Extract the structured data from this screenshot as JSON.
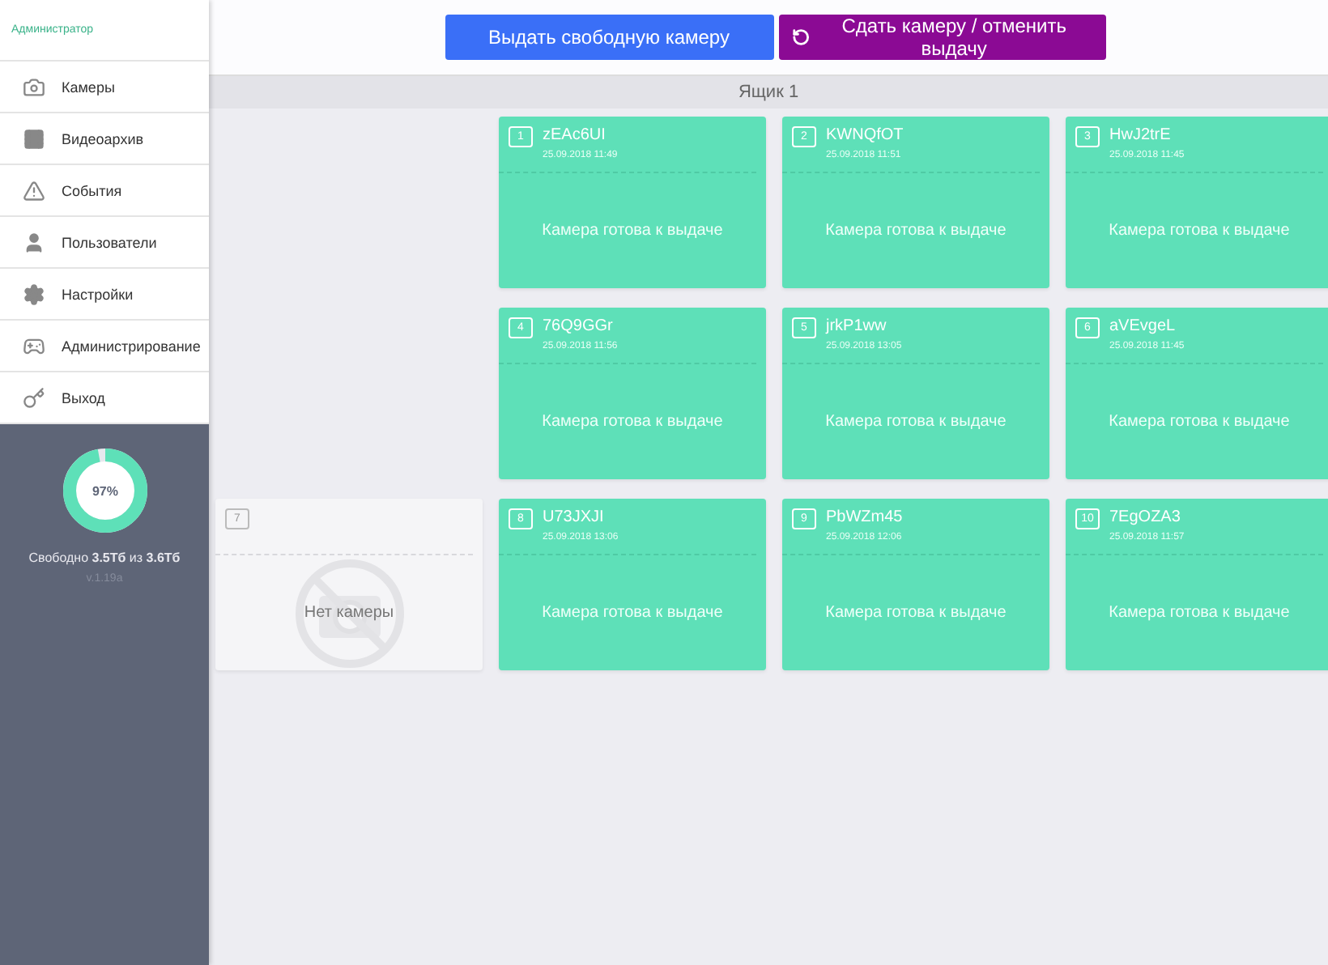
{
  "sidebar": {
    "role": "Администратор",
    "items": [
      {
        "label": "Камеры"
      },
      {
        "label": "Видеоархив"
      },
      {
        "label": "События"
      },
      {
        "label": "Пользователи"
      },
      {
        "label": "Настройки"
      },
      {
        "label": "Администрирование"
      },
      {
        "label": "Выход"
      }
    ],
    "storage": {
      "level": 0.97,
      "percent": "97%",
      "free": "Свободно **3.5Тб** из **3.6Тб**",
      "version": "v.1.19a"
    }
  },
  "toolbar": {
    "issue_button": "Выдать свободную камеру",
    "return_button": "Сдать камеру / отменить выдачу"
  },
  "box": {
    "title": "Ящик 1",
    "slots": [
      {
        "kind": "blank"
      },
      {
        "kind": "camera",
        "number": "1",
        "name": "zEAc6UI",
        "date": "25.09.2018 11:49",
        "status": "Камера готова к выдаче"
      },
      {
        "kind": "camera",
        "number": "2",
        "name": "KWNQfOT",
        "date": "25.09.2018 11:51",
        "status": "Камера готова к выдаче"
      },
      {
        "kind": "camera",
        "number": "3",
        "name": "HwJ2trE",
        "date": "25.09.2018 11:45",
        "status": "Камера готова к выдаче"
      },
      {
        "kind": "blank"
      },
      {
        "kind": "camera",
        "number": "4",
        "name": "76Q9GGr",
        "date": "25.09.2018 11:56",
        "status": "Камера готова к выдаче"
      },
      {
        "kind": "camera",
        "number": "5",
        "name": "jrkP1ww",
        "date": "25.09.2018 13:05",
        "status": "Камера готова к выдаче"
      },
      {
        "kind": "camera",
        "number": "6",
        "name": "aVEvgeL",
        "date": "25.09.2018 11:45",
        "status": "Камера готова к выдаче"
      },
      {
        "kind": "empty",
        "number": "7",
        "status": "Нет камеры"
      },
      {
        "kind": "camera",
        "number": "8",
        "name": "U73JXJI",
        "date": "25.09.2018 13:06",
        "status": "Камера готова к выдаче"
      },
      {
        "kind": "camera",
        "number": "9",
        "name": "PbWZm45",
        "date": "25.09.2018 12:06",
        "status": "Камера готова к выдаче"
      },
      {
        "kind": "camera",
        "number": "10",
        "name": "7EgOZA3",
        "date": "25.09.2018 11:57",
        "status": "Камера готова к выдаче"
      }
    ]
  }
}
